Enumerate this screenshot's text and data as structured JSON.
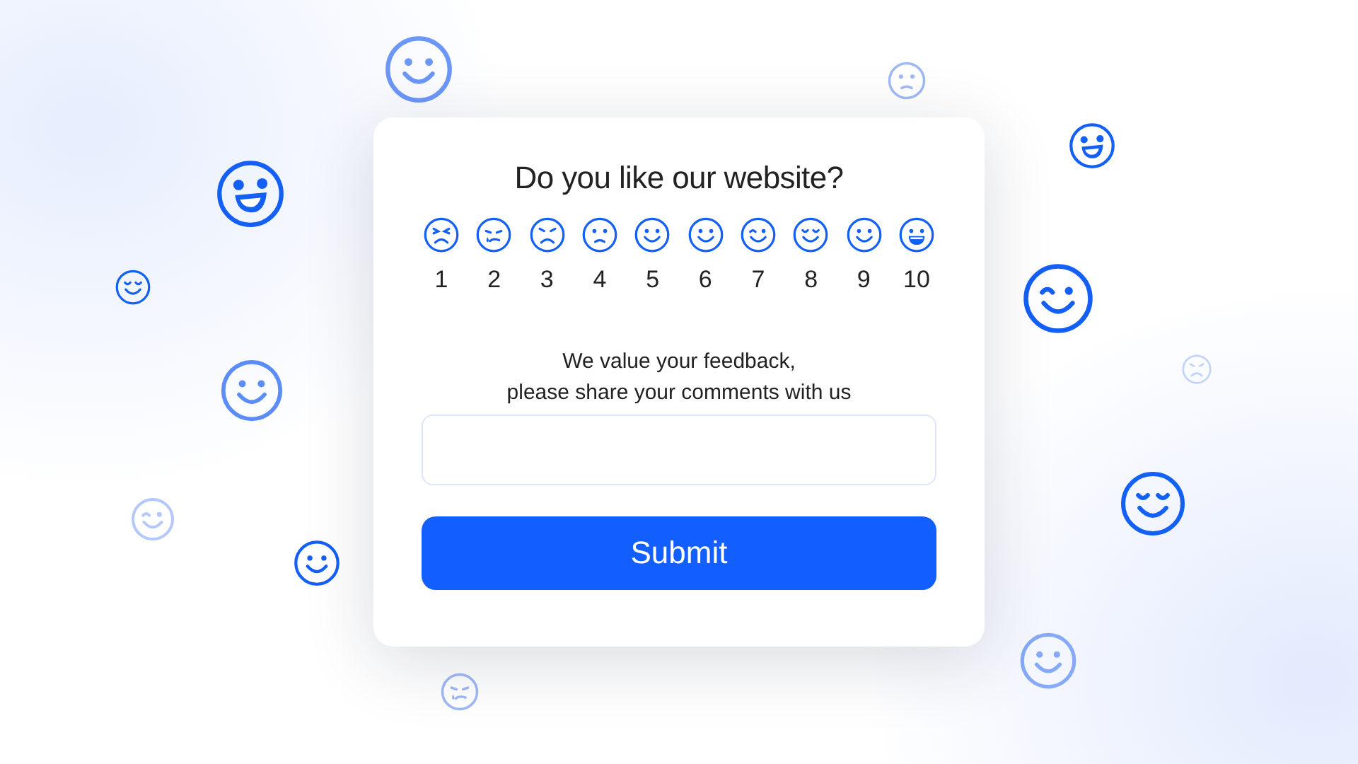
{
  "survey": {
    "title": "Do you like our website?",
    "rating": {
      "options": [
        {
          "label": "1"
        },
        {
          "label": "2"
        },
        {
          "label": "3"
        },
        {
          "label": "4"
        },
        {
          "label": "5"
        },
        {
          "label": "6"
        },
        {
          "label": "7"
        },
        {
          "label": "8"
        },
        {
          "label": "9"
        },
        {
          "label": "10"
        }
      ]
    },
    "prompt": [
      "We value your feedback,",
      "please share your comments with us"
    ],
    "comment_field": {
      "kind": "textbox"
    },
    "submit_button": {
      "label": "Submit"
    }
  }
}
